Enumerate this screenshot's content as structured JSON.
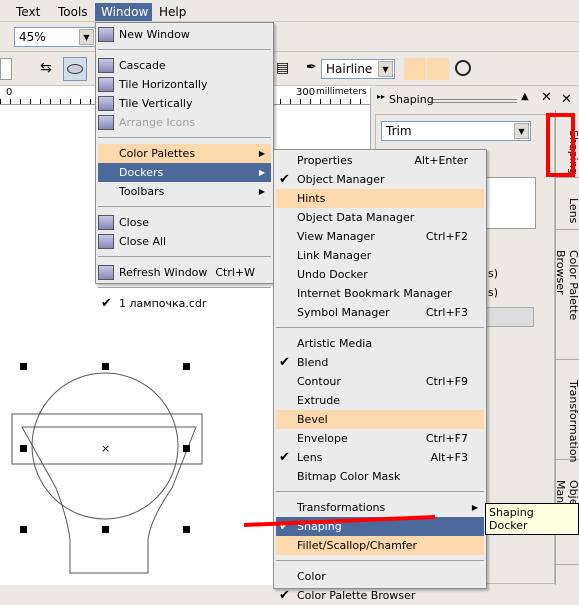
{
  "menubar": {
    "items": [
      "Text",
      "Tools",
      "Window",
      "Help"
    ]
  },
  "toolbar": {
    "zoom": "45%",
    "outline": "Hairline"
  },
  "ruler": {
    "label_0": "0",
    "label_300": "300",
    "units": "millimeters"
  },
  "window_menu": [
    {
      "label": "New Window",
      "icon": "new-window-icon"
    },
    {
      "sep": true
    },
    {
      "label": "Cascade",
      "icon": "cascade-icon"
    },
    {
      "label": "Tile Horizontally",
      "icon": "tile-horizontal-icon"
    },
    {
      "label": "Tile Vertically",
      "icon": "tile-vertical-icon"
    },
    {
      "label": "Arrange Icons",
      "disabled": true,
      "icon": "arrange-icons-icon"
    },
    {
      "sep": true
    },
    {
      "label": "Color Palettes",
      "submenu": true,
      "state": "hover"
    },
    {
      "label": "Dockers",
      "submenu": true,
      "state": "selected"
    },
    {
      "label": "Toolbars",
      "submenu": true
    },
    {
      "sep": true
    },
    {
      "label": "Close",
      "icon": "close-window-icon"
    },
    {
      "label": "Close All",
      "icon": "close-all-icon"
    },
    {
      "sep": true
    },
    {
      "label": "Refresh Window",
      "shortcut": "Ctrl+W",
      "icon": "refresh-icon"
    },
    {
      "sep": true
    },
    {
      "label": "1 лампочка.cdr",
      "checked": true
    }
  ],
  "dockers_menu": [
    {
      "label": "Properties",
      "shortcut": "Alt+Enter"
    },
    {
      "label": "Object Manager",
      "checked": true
    },
    {
      "label": "Hints",
      "state": "hover"
    },
    {
      "label": "Object Data Manager"
    },
    {
      "label": "View Manager",
      "shortcut": "Ctrl+F2"
    },
    {
      "label": "Link Manager"
    },
    {
      "label": "Undo Docker"
    },
    {
      "label": "Internet Bookmark Manager"
    },
    {
      "label": "Symbol Manager",
      "shortcut": "Ctrl+F3"
    },
    {
      "sep": true
    },
    {
      "label": "Artistic Media"
    },
    {
      "label": "Blend",
      "checked": true
    },
    {
      "label": "Contour",
      "shortcut": "Ctrl+F9"
    },
    {
      "label": "Extrude"
    },
    {
      "label": "Bevel",
      "state": "hover"
    },
    {
      "label": "Envelope",
      "shortcut": "Ctrl+F7"
    },
    {
      "label": "Lens",
      "checked": true,
      "shortcut": "Alt+F3"
    },
    {
      "label": "Bitmap Color Mask"
    },
    {
      "sep": true
    },
    {
      "label": "Transformations",
      "submenu": true
    },
    {
      "label": "Shaping",
      "checked": true,
      "state": "selected"
    },
    {
      "label": "Fillet/Scallop/Chamfer",
      "state": "hover"
    },
    {
      "sep": true
    },
    {
      "label": "Color"
    },
    {
      "label": "Color Palette Browser",
      "checked": true
    }
  ],
  "tooltip": "Shaping Docker",
  "docker": {
    "title": "Shaping",
    "mode": "Trim",
    "frag1": "s)",
    "frag2": "s)"
  },
  "vertical_tabs": [
    "Shaping",
    "Lens",
    "Color Palette Browser",
    "Transformation",
    "Object Manager"
  ],
  "colors": {
    "menu_selected": "#4b6a9b",
    "menu_hover": "#fcd9ad",
    "annotation": "#ff0000"
  }
}
